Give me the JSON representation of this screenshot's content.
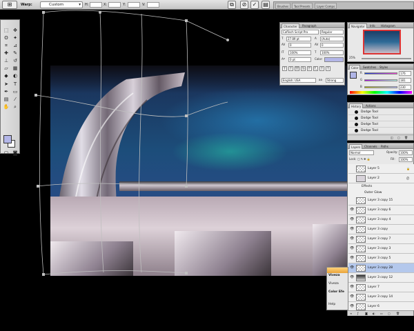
{
  "options_bar": {
    "warp_label": "Warp:",
    "warp_value": "Custom",
    "h_label": "H:",
    "v_label": "V:",
    "x_label": "X:",
    "y_label": "Y:"
  },
  "workspace_tabs": [
    "Brushes",
    "Tool Presets",
    "Layer Comps"
  ],
  "character_panel": {
    "tabs": [
      "Character",
      "Paragraph"
    ],
    "font_family": "Caflisch Script Pro",
    "font_style": "Regular",
    "font_size": "27.89 pt",
    "leading": "(Auto)",
    "kerning": "0",
    "tracking": "0",
    "vscale": "100%",
    "hscale": "100%",
    "baseline": "0 pt",
    "color_label": "Color:",
    "language": "English: USA",
    "antialias": "Strong",
    "style_buttons": [
      "T",
      "T",
      "TT",
      "Tr",
      "T'",
      "T,",
      "T",
      "T"
    ]
  },
  "navigator_panel": {
    "tabs": [
      "Navigator",
      "Info",
      "Histogram"
    ],
    "zoom": "25%"
  },
  "color_panel": {
    "tabs": [
      "Color",
      "Swatches",
      "Styles"
    ],
    "channels": [
      {
        "label": "R",
        "value": "176"
      },
      {
        "label": "G",
        "value": "181"
      },
      {
        "label": "B",
        "value": "230"
      }
    ],
    "fg_color": "#b0b5e6"
  },
  "history_panel": {
    "tabs": [
      "History",
      "Actions"
    ],
    "items": [
      "Dodge Tool",
      "Dodge Tool",
      "Dodge Tool",
      "Dodge Tool"
    ]
  },
  "layers_panel": {
    "tabs": [
      "Layers",
      "Channels",
      "Paths"
    ],
    "blend_mode": "Normal",
    "opacity_label": "Opacity:",
    "opacity": "100%",
    "lock_label": "Lock:",
    "fill_label": "Fill:",
    "fill": "100%",
    "effects_label": "Effects",
    "effect_item": "Outer Glow",
    "layers": [
      "Layer 5",
      "Layer 2",
      "Layer 3 copy 15",
      "Layer 3 copy 6",
      "Layer 3 copy 4",
      "Layer 3 copy",
      "Layer 3 copy 7",
      "Layer 3 copy 3",
      "Layer 3 copy 5",
      "Layer 3 copy 28",
      "Layer 3 copy 12",
      "Layer 7",
      "Layer 3 copy 14",
      "Layer 6"
    ],
    "selected_layer": "Layer 3 copy 28"
  },
  "viveza_panel": {
    "title": "Viveza",
    "items": [
      "Viveza",
      "Color Efe",
      "Help"
    ]
  }
}
